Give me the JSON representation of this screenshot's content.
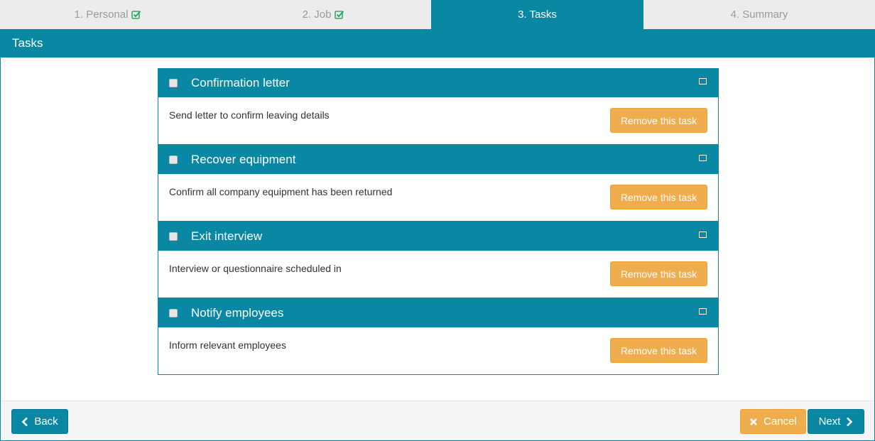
{
  "steps": [
    {
      "label": "1. Personal",
      "completed": true,
      "active": false
    },
    {
      "label": "2. Job",
      "completed": true,
      "active": false
    },
    {
      "label": "3. Tasks",
      "completed": false,
      "active": true
    },
    {
      "label": "4. Summary",
      "completed": false,
      "active": false
    }
  ],
  "panel": {
    "title": "Tasks"
  },
  "tasks": [
    {
      "title": "Confirmation letter",
      "description": "Send letter to confirm leaving details",
      "remove_label": "Remove this task"
    },
    {
      "title": "Recover equipment",
      "description": "Confirm all company equipment has been returned",
      "remove_label": "Remove this task"
    },
    {
      "title": "Exit interview",
      "description": "Interview or questionnaire scheduled in",
      "remove_label": "Remove this task"
    },
    {
      "title": "Notify employees",
      "description": "Inform relevant employees",
      "remove_label": "Remove this task"
    }
  ],
  "footer": {
    "back_label": "Back",
    "cancel_label": "Cancel",
    "next_label": "Next"
  },
  "colors": {
    "primary": "#0a87a3",
    "warning": "#f0ad4e",
    "success": "#2fa66a",
    "inactive_text": "#9a9a9a"
  },
  "icons": {
    "completed": "check-square-icon",
    "back": "chevron-left-icon",
    "cancel": "times-icon",
    "next": "chevron-right-icon",
    "task_expand": "window-maximize-icon"
  }
}
